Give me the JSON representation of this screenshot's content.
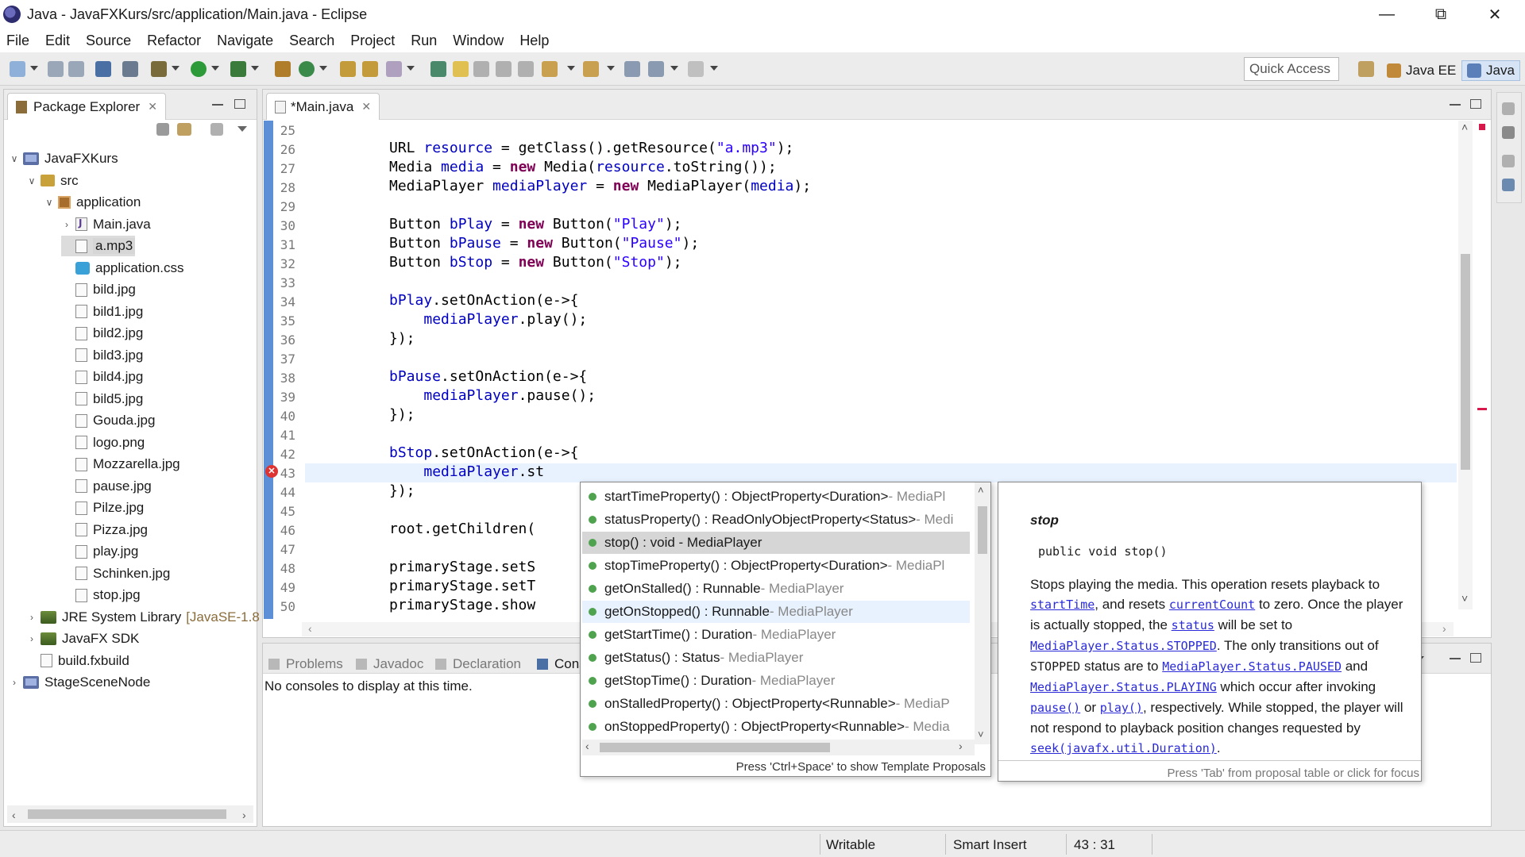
{
  "window": {
    "title": "Java - JavaFXKurs/src/application/Main.java - Eclipse",
    "minimize": "—",
    "restore": "⧉",
    "close": "✕"
  },
  "menubar": [
    "File",
    "Edit",
    "Source",
    "Refactor",
    "Navigate",
    "Search",
    "Project",
    "Run",
    "Window",
    "Help"
  ],
  "toolbar": {
    "quick_access": "Quick Access",
    "perspectives": [
      "Java EE",
      "Java"
    ]
  },
  "package_explorer": {
    "title": "Package Explorer",
    "tree": [
      {
        "label": "JavaFXKurs",
        "kind": "project",
        "level": 0,
        "twisty": "∨"
      },
      {
        "label": "src",
        "kind": "folder",
        "level": 1,
        "twisty": "∨"
      },
      {
        "label": "application",
        "kind": "package",
        "level": 2,
        "twisty": "∨"
      },
      {
        "label": "Main.java",
        "kind": "java",
        "level": 3,
        "twisty": "›"
      },
      {
        "label": "a.mp3",
        "kind": "file",
        "level": 3,
        "twisty": "",
        "selected": true
      },
      {
        "label": "application.css",
        "kind": "css",
        "level": 3,
        "twisty": ""
      },
      {
        "label": "bild.jpg",
        "kind": "file",
        "level": 3,
        "twisty": ""
      },
      {
        "label": "bild1.jpg",
        "kind": "file",
        "level": 3,
        "twisty": ""
      },
      {
        "label": "bild2.jpg",
        "kind": "file",
        "level": 3,
        "twisty": ""
      },
      {
        "label": "bild3.jpg",
        "kind": "file",
        "level": 3,
        "twisty": ""
      },
      {
        "label": "bild4.jpg",
        "kind": "file",
        "level": 3,
        "twisty": ""
      },
      {
        "label": "bild5.jpg",
        "kind": "file",
        "level": 3,
        "twisty": ""
      },
      {
        "label": "Gouda.jpg",
        "kind": "file",
        "level": 3,
        "twisty": ""
      },
      {
        "label": "logo.png",
        "kind": "file",
        "level": 3,
        "twisty": ""
      },
      {
        "label": "Mozzarella.jpg",
        "kind": "file",
        "level": 3,
        "twisty": ""
      },
      {
        "label": "pause.jpg",
        "kind": "file",
        "level": 3,
        "twisty": ""
      },
      {
        "label": "Pilze.jpg",
        "kind": "file",
        "level": 3,
        "twisty": ""
      },
      {
        "label": "Pizza.jpg",
        "kind": "file",
        "level": 3,
        "twisty": ""
      },
      {
        "label": "play.jpg",
        "kind": "file",
        "level": 3,
        "twisty": ""
      },
      {
        "label": "Schinken.jpg",
        "kind": "file",
        "level": 3,
        "twisty": ""
      },
      {
        "label": "stop.jpg",
        "kind": "file",
        "level": 3,
        "twisty": ""
      },
      {
        "label": "JRE System Library",
        "decor": "[JavaSE-1.8",
        "kind": "library",
        "level": 1,
        "twisty": "›"
      },
      {
        "label": "JavaFX SDK",
        "kind": "library",
        "level": 1,
        "twisty": "›"
      },
      {
        "label": "build.fxbuild",
        "kind": "file",
        "level": 1,
        "twisty": ""
      },
      {
        "label": "StageSceneNode",
        "kind": "project",
        "level": 0,
        "twisty": "›"
      }
    ]
  },
  "editor": {
    "tab": "*Main.java",
    "line_numbers": [
      "25",
      "26",
      "27",
      "28",
      "29",
      "30",
      "31",
      "32",
      "33",
      "34",
      "35",
      "36",
      "37",
      "38",
      "39",
      "40",
      "41",
      "42",
      "43",
      "44",
      "45",
      "46",
      "47",
      "48",
      "49",
      "50"
    ],
    "lines": [
      [],
      [
        [
          "t",
          "URL "
        ],
        [
          "f",
          "resource"
        ],
        [
          "t",
          " = getClass().getResource("
        ],
        [
          "s",
          "\"a.mp3\""
        ],
        [
          "t",
          ");"
        ]
      ],
      [
        [
          "t",
          "Media "
        ],
        [
          "f",
          "media"
        ],
        [
          "t",
          " = "
        ],
        [
          "k",
          "new"
        ],
        [
          "t",
          " Media("
        ],
        [
          "f",
          "resource"
        ],
        [
          "t",
          ".toString());"
        ]
      ],
      [
        [
          "t",
          "MediaPlayer "
        ],
        [
          "f",
          "mediaPlayer"
        ],
        [
          "t",
          " = "
        ],
        [
          "k",
          "new"
        ],
        [
          "t",
          " MediaPlayer("
        ],
        [
          "f",
          "media"
        ],
        [
          "t",
          ");"
        ]
      ],
      [],
      [
        [
          "t",
          "Button "
        ],
        [
          "f",
          "bPlay"
        ],
        [
          "t",
          " = "
        ],
        [
          "k",
          "new"
        ],
        [
          "t",
          " Button("
        ],
        [
          "s",
          "\"Play\""
        ],
        [
          "t",
          ");"
        ]
      ],
      [
        [
          "t",
          "Button "
        ],
        [
          "f",
          "bPause"
        ],
        [
          "t",
          " = "
        ],
        [
          "k",
          "new"
        ],
        [
          "t",
          " Button("
        ],
        [
          "s",
          "\"Pause\""
        ],
        [
          "t",
          ");"
        ]
      ],
      [
        [
          "t",
          "Button "
        ],
        [
          "f",
          "bStop"
        ],
        [
          "t",
          " = "
        ],
        [
          "k",
          "new"
        ],
        [
          "t",
          " Button("
        ],
        [
          "s",
          "\"Stop\""
        ],
        [
          "t",
          ");"
        ]
      ],
      [],
      [
        [
          "f",
          "bPlay"
        ],
        [
          "t",
          ".setOnAction(e->{"
        ]
      ],
      [
        [
          "t",
          "    "
        ],
        [
          "f",
          "mediaPlayer"
        ],
        [
          "t",
          ".play();"
        ]
      ],
      [
        [
          "t",
          "});"
        ]
      ],
      [],
      [
        [
          "f",
          "bPause"
        ],
        [
          "t",
          ".setOnAction(e->{"
        ]
      ],
      [
        [
          "t",
          "    "
        ],
        [
          "f",
          "mediaPlayer"
        ],
        [
          "t",
          ".pause();"
        ]
      ],
      [
        [
          "t",
          "});"
        ]
      ],
      [],
      [
        [
          "f",
          "bStop"
        ],
        [
          "t",
          ".setOnAction(e->{"
        ]
      ],
      [
        [
          "t",
          "    "
        ],
        [
          "f",
          "mediaPlayer"
        ],
        [
          "t",
          ".st"
        ]
      ],
      [
        [
          "t",
          "});"
        ]
      ],
      [],
      [
        [
          "t",
          "root.getChildren("
        ]
      ],
      [],
      [
        [
          "t",
          "primaryStage.setS"
        ]
      ],
      [
        [
          "t",
          "primaryStage.setT"
        ]
      ],
      [
        [
          "t",
          "primaryStage.show"
        ]
      ]
    ]
  },
  "autocomplete": {
    "items": [
      {
        "sig": "startTimeProperty() : ObjectProperty<Duration>",
        "owner": " - MediaPl"
      },
      {
        "sig": "statusProperty() : ReadOnlyObjectProperty<Status>",
        "owner": " - Medi"
      },
      {
        "sig": "stop() : void - MediaPlayer",
        "owner": ""
      },
      {
        "sig": "stopTimeProperty() : ObjectProperty<Duration>",
        "owner": " - MediaPl"
      },
      {
        "sig": "getOnStalled() : Runnable",
        "owner": " - MediaPlayer"
      },
      {
        "sig": "getOnStopped() : Runnable",
        "owner": " - MediaPlayer"
      },
      {
        "sig": "getStartTime() : Duration",
        "owner": " - MediaPlayer"
      },
      {
        "sig": "getStatus() : Status",
        "owner": " - MediaPlayer"
      },
      {
        "sig": "getStopTime() : Duration",
        "owner": " - MediaPlayer"
      },
      {
        "sig": "onStalledProperty() : ObjectProperty<Runnable>",
        "owner": " - MediaP"
      },
      {
        "sig": "onStoppedProperty() : ObjectProperty<Runnable>",
        "owner": " - Media"
      }
    ],
    "footer": "Press 'Ctrl+Space' to show Template Proposals"
  },
  "javadoc": {
    "title": "stop",
    "signature": "public void stop()",
    "body": [
      [
        "t",
        "Stops playing the media. This operation resets playback to "
      ],
      [
        "l",
        "startTime"
      ],
      [
        "t",
        ", and resets "
      ],
      [
        "l",
        "currentCount"
      ],
      [
        "t",
        " to zero. Once the player is actually stopped, the "
      ],
      [
        "l",
        "status"
      ],
      [
        "t",
        " will be set to "
      ],
      [
        "l",
        "MediaPlayer.Status.STOPPED"
      ],
      [
        "t",
        ". The only transitions out of "
      ],
      [
        "m",
        "STOPPED"
      ],
      [
        "t",
        " status are to "
      ],
      [
        "l",
        "MediaPlayer.Status.PAUSED"
      ],
      [
        "t",
        " and "
      ],
      [
        "l",
        "MediaPlayer.Status.PLAYING"
      ],
      [
        "t",
        " which occur after invoking "
      ],
      [
        "l",
        "pause()"
      ],
      [
        "t",
        " or "
      ],
      [
        "l",
        "play()"
      ],
      [
        "t",
        ", respectively. While stopped, the player will not respond to playback position changes requested by "
      ],
      [
        "l",
        "seek(javafx.util.Duration)"
      ],
      [
        "t",
        "."
      ]
    ],
    "footer": "Press 'Tab' from proposal table or click for focus"
  },
  "bottom_panel": {
    "tabs": [
      "Problems",
      "Javadoc",
      "Declaration",
      "Cons"
    ],
    "message": "No consoles to display at this time."
  },
  "statusbar": {
    "mode": "Writable",
    "insert": "Smart Insert",
    "position": "43 : 31"
  }
}
